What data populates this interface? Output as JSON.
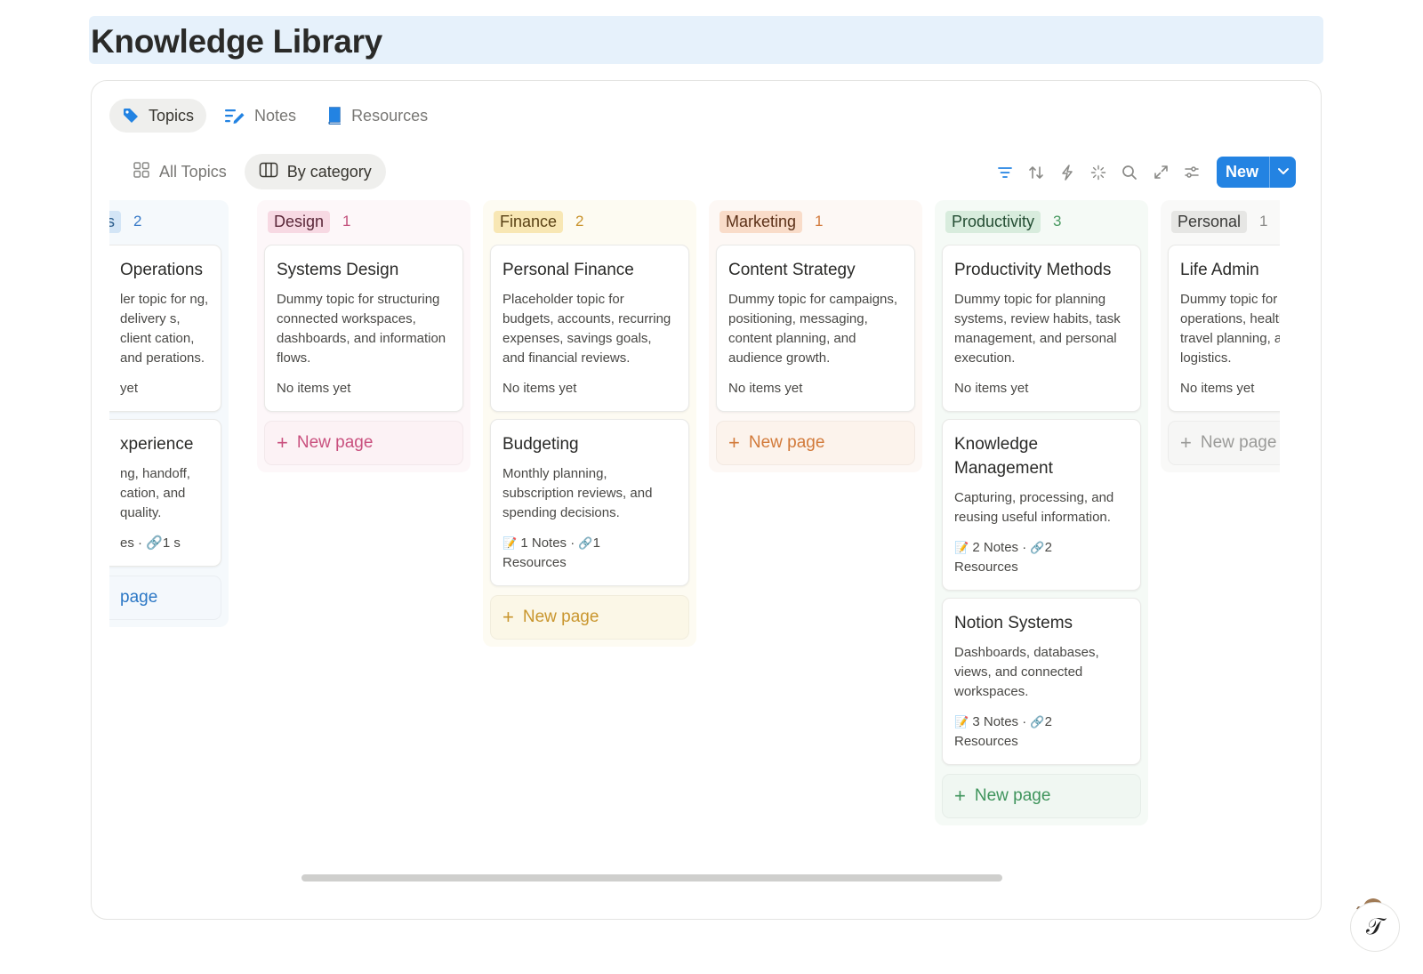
{
  "page": {
    "title": "Knowledge Library"
  },
  "db_tabs": [
    {
      "label": "Topics",
      "icon": "tag-icon",
      "active": true
    },
    {
      "label": "Notes",
      "icon": "notes-icon",
      "active": false
    },
    {
      "label": "Resources",
      "icon": "book-icon",
      "active": false
    }
  ],
  "views": [
    {
      "label": "All Topics",
      "icon": "grid-icon",
      "active": false
    },
    {
      "label": "By category",
      "icon": "board-icon",
      "active": true
    }
  ],
  "toolbar": {
    "icons": [
      "filter-icon",
      "sort-icon",
      "automation-icon",
      "ai-sparkle-icon",
      "search-icon",
      "expand-icon",
      "settings-icon"
    ],
    "new_label": "New"
  },
  "new_page_label": "New page",
  "columns": [
    {
      "name": "s",
      "count": "2",
      "tag_bg": "#d3e5f6",
      "tag_fg": "#2b5d8c",
      "count_fg": "#3a7bc8",
      "col_bg": "#f5f9fc",
      "new_fg": "#2b77c5",
      "new_bg": "#f4f8fc",
      "new_label": "page",
      "cards": [
        {
          "title": "Operations",
          "desc": "ler topic for ng, delivery s, client cation, and perations.",
          "meta": "yet"
        },
        {
          "title": "xperience",
          "desc": "ng, handoff, cation, and quality.",
          "meta": "es · 🔗1 s"
        }
      ]
    },
    {
      "name": "Design",
      "count": "1",
      "tag_bg": "#f7d9e3",
      "tag_fg": "#5a2738",
      "count_fg": "#c2517c",
      "col_bg": "#fdf7f9",
      "new_fg": "#c9507e",
      "new_bg": "#fcf2f5",
      "new_label": "New page",
      "cards": [
        {
          "title": "Systems Design",
          "desc": "Dummy topic for structuring connected workspaces, dashboards, and information flows.",
          "meta": "No items yet"
        }
      ]
    },
    {
      "name": "Finance",
      "count": "2",
      "tag_bg": "#f8e7b4",
      "tag_fg": "#5a4215",
      "count_fg": "#c9932c",
      "col_bg": "#fdfbf2",
      "new_fg": "#c9962e",
      "new_bg": "#fbf7e7",
      "new_label": "New page",
      "cards": [
        {
          "title": "Personal Finance",
          "desc": "Placeholder topic for budgets, accounts, recurring expenses, savings goals, and financial reviews.",
          "meta": "No items yet"
        },
        {
          "title": "Budgeting",
          "desc": "Monthly planning, subscription reviews, and spending decisions.",
          "meta_notes": "1 Notes",
          "meta_res": "1",
          "meta_res_label": "Resources"
        }
      ]
    },
    {
      "name": "Marketing",
      "count": "1",
      "tag_bg": "#f9dcc9",
      "tag_fg": "#5c3118",
      "count_fg": "#d27a3c",
      "col_bg": "#fdf8f5",
      "new_fg": "#d27a3a",
      "new_bg": "#fcf3ec",
      "new_label": "New page",
      "cards": [
        {
          "title": "Content Strategy",
          "desc": "Dummy topic for campaigns, positioning, messaging, content planning, and audience growth.",
          "meta": "No items yet"
        }
      ]
    },
    {
      "name": "Productivity",
      "count": "3",
      "tag_bg": "#d8ecdd",
      "tag_fg": "#244d33",
      "count_fg": "#4a9a62",
      "col_bg": "#f5faf6",
      "new_fg": "#3f945c",
      "new_bg": "#f0f7f2",
      "new_label": "New page",
      "cards": [
        {
          "title": "Productivity Methods",
          "desc": "Dummy topic for planning systems, review habits, task management, and personal execution.",
          "meta": "No items yet"
        },
        {
          "title": "Knowledge Management",
          "desc": "Capturing, processing, and reusing useful information.",
          "meta_notes": "2 Notes",
          "meta_res": "2",
          "meta_res_label": "Resources"
        },
        {
          "title": "Notion Systems",
          "desc": "Dashboards, databases, views, and connected workspaces.",
          "meta_notes": "3 Notes",
          "meta_res": "2",
          "meta_res_label": "Resources"
        }
      ]
    },
    {
      "name": "Personal",
      "count": "1",
      "tag_bg": "#e6e6e4",
      "tag_fg": "#3a3a38",
      "count_fg": "#8a8a88",
      "col_bg": "#f9f9f8",
      "new_fg": "#9a9a98",
      "new_bg": "#f6f6f5",
      "new_label": "New page",
      "cards": [
        {
          "title": "Life Admin",
          "desc": "Dummy topic for household operations, health notes, travel planning, and personal logistics.",
          "meta": "No items yet"
        }
      ]
    }
  ]
}
